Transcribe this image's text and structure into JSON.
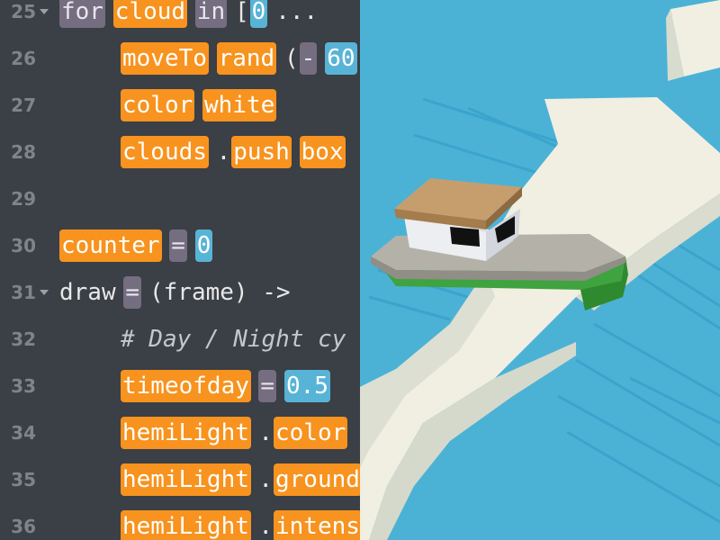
{
  "colors": {
    "editor_bg": "#3b3f46",
    "token_keyword": "#f7931e",
    "token_operator": "#756d80",
    "token_number": "#58b4d6",
    "water": "#4bb2d6",
    "water_dark": "#37a3cb",
    "rock": "#f1efe2",
    "boat_hull": "#b4b2a8",
    "boat_roof": "#c69e6e",
    "boat_green": "#3fa33f"
  },
  "editor": {
    "lines": [
      {
        "num": "25",
        "fold": true,
        "tokens": [
          {
            "t": "for",
            "k": "gr"
          },
          {
            "t": "cloud",
            "k": "or"
          },
          {
            "t": "in",
            "k": "gr"
          },
          {
            "t": "[",
            "k": "pl"
          },
          {
            "t": "0",
            "k": "bl"
          },
          {
            "t": "...",
            "k": "pl"
          }
        ]
      },
      {
        "num": "26",
        "fold": false,
        "tokens": [
          {
            "t": "moveTo",
            "k": "or"
          },
          {
            "t": "rand",
            "k": "or"
          },
          {
            "t": "(",
            "k": "pl"
          },
          {
            "t": "-",
            "k": "gr"
          },
          {
            "t": "60",
            "k": "bl"
          },
          {
            "t": ",",
            "k": "pl"
          }
        ]
      },
      {
        "num": "27",
        "fold": false,
        "tokens": [
          {
            "t": "color",
            "k": "or"
          },
          {
            "t": "white",
            "k": "or"
          }
        ]
      },
      {
        "num": "28",
        "fold": false,
        "tokens": [
          {
            "t": "clouds",
            "k": "or"
          },
          {
            "t": ".",
            "k": "pl"
          },
          {
            "t": "push",
            "k": "or"
          },
          {
            "t": "box",
            "k": "or"
          }
        ]
      },
      {
        "num": "29",
        "fold": false,
        "tokens": []
      },
      {
        "num": "30",
        "fold": false,
        "tokens": [
          {
            "t": "counter",
            "k": "or"
          },
          {
            "t": "=",
            "k": "gr"
          },
          {
            "t": "0",
            "k": "bl"
          }
        ]
      },
      {
        "num": "31",
        "fold": true,
        "tokens": [
          {
            "t": "draw",
            "k": "pl"
          },
          {
            "t": "=",
            "k": "gr"
          },
          {
            "t": "(frame) ->",
            "k": "pl"
          }
        ]
      },
      {
        "num": "32",
        "fold": false,
        "tokens": [
          {
            "t": "# Day / Night cy",
            "k": "cm"
          }
        ]
      },
      {
        "num": "33",
        "fold": false,
        "tokens": [
          {
            "t": "timeofday",
            "k": "or"
          },
          {
            "t": "=",
            "k": "gr"
          },
          {
            "t": "0.5",
            "k": "bl"
          }
        ]
      },
      {
        "num": "34",
        "fold": false,
        "tokens": [
          {
            "t": "hemiLight",
            "k": "or"
          },
          {
            "t": ".",
            "k": "pl"
          },
          {
            "t": "color",
            "k": "or"
          }
        ]
      },
      {
        "num": "35",
        "fold": false,
        "tokens": [
          {
            "t": "hemiLight",
            "k": "or"
          },
          {
            "t": ".",
            "k": "pl"
          },
          {
            "t": "ground",
            "k": "or"
          }
        ]
      },
      {
        "num": "36",
        "fold": false,
        "tokens": [
          {
            "t": "hemiLight",
            "k": "or"
          },
          {
            "t": ".",
            "k": "pl"
          },
          {
            "t": "intens",
            "k": "or"
          }
        ]
      }
    ]
  }
}
